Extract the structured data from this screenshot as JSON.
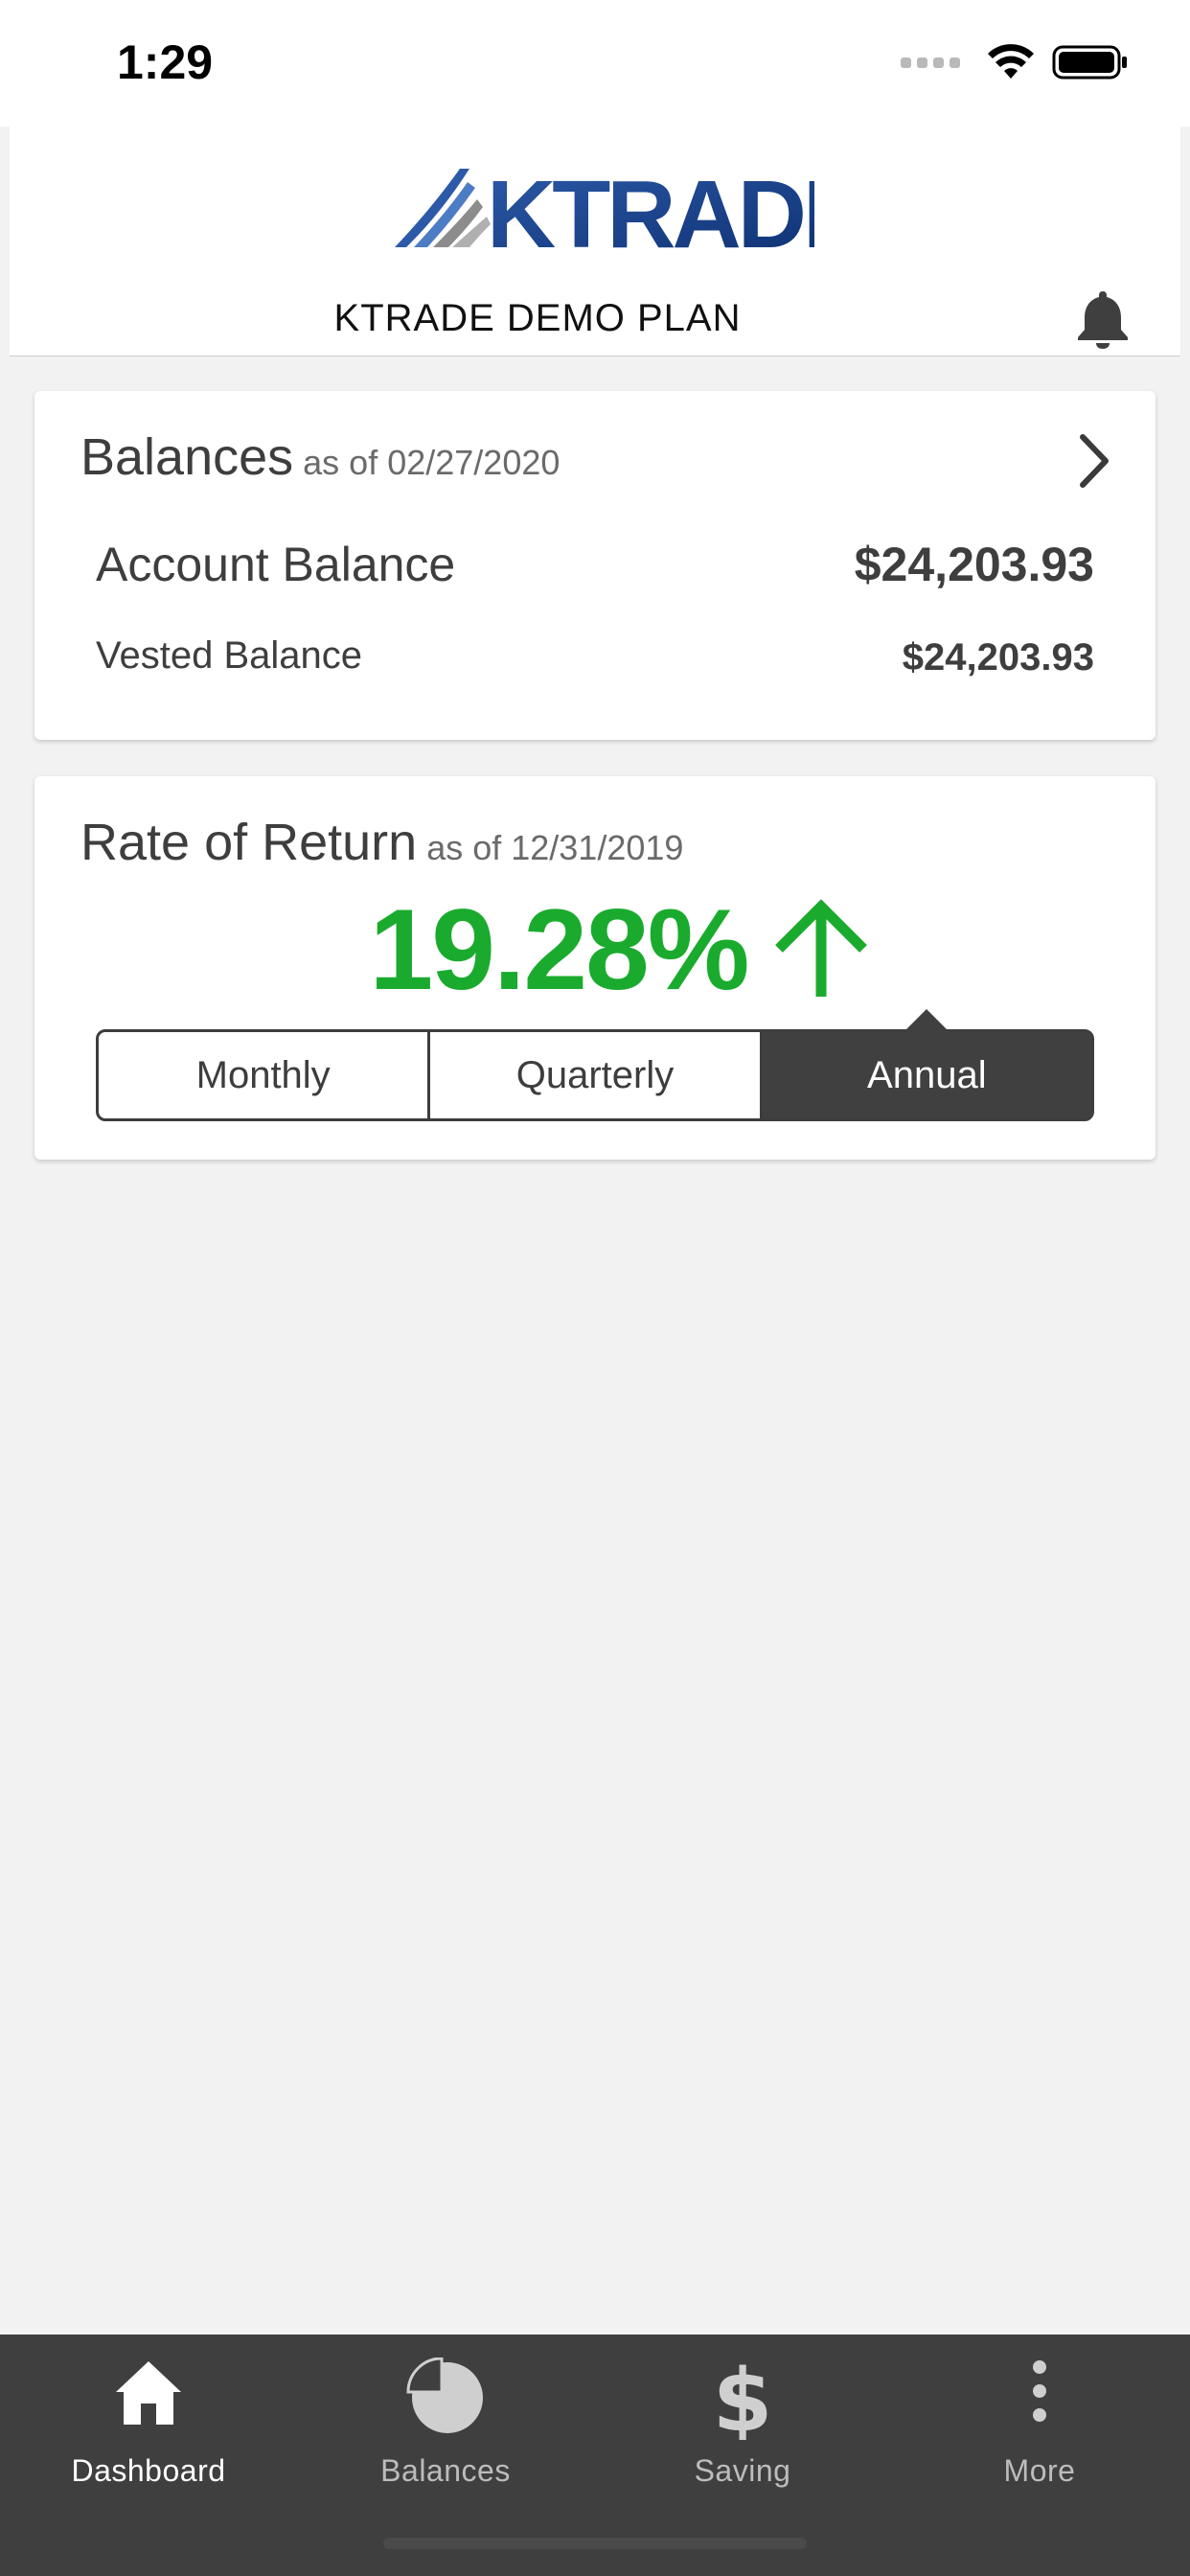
{
  "status_bar": {
    "time": "1:29"
  },
  "header": {
    "logo_text": "KTRADE",
    "plan_name": "KTRADE DEMO PLAN",
    "notifications_icon": "bell-icon"
  },
  "balances": {
    "title": "Balances",
    "as_of": "as of 02/27/2020",
    "account_label": "Account Balance",
    "account_value": "$24,203.93",
    "vested_label": "Vested Balance",
    "vested_value": "$24,203.93"
  },
  "rate_of_return": {
    "title": "Rate of Return",
    "as_of": "as of 12/31/2019",
    "value": "19.28%",
    "trend": "up",
    "value_color": "#1aab2e",
    "periods": [
      "Monthly",
      "Quarterly",
      "Annual"
    ],
    "selected_period": "Annual"
  },
  "tab_bar": {
    "tabs": [
      {
        "label": "Dashboard",
        "icon": "home-icon",
        "active": true
      },
      {
        "label": "Balances",
        "icon": "pie-chart-icon",
        "active": false
      },
      {
        "label": "Saving",
        "icon": "dollar-icon",
        "active": false
      },
      {
        "label": "More",
        "icon": "more-vertical-icon",
        "active": false
      }
    ]
  }
}
